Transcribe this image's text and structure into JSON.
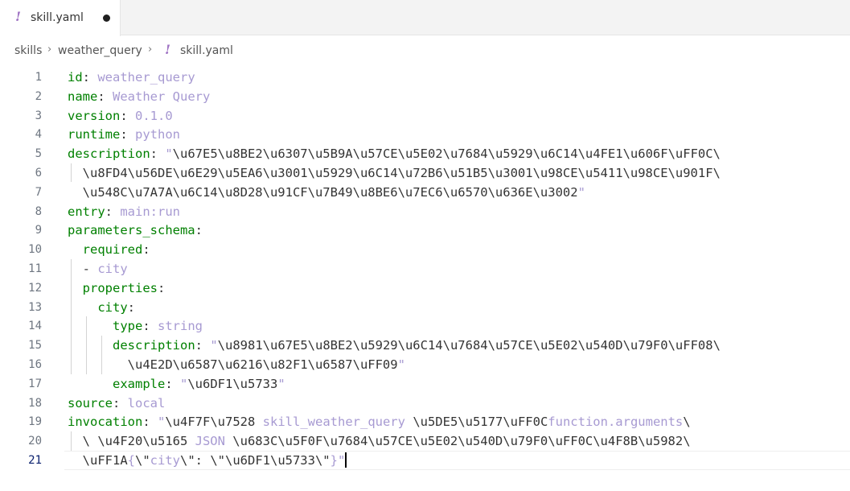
{
  "tab": {
    "icon": "yaml-exclamation-icon",
    "icon_glyph": "!",
    "label": "skill.yaml",
    "modified": true
  },
  "breadcrumb": {
    "items": [
      "skills",
      "weather_query",
      "skill.yaml"
    ],
    "separator": "›",
    "icon_glyph": "!"
  },
  "colors": {
    "key": "#008000",
    "value": "#a79ad2",
    "punctuation": "#333333",
    "yaml_icon": "#a074c4"
  },
  "cursor_line": 21,
  "lines": [
    {
      "n": "1",
      "tokens": [
        {
          "t": "id",
          "c": "k"
        },
        {
          "t": ": ",
          "c": "p"
        },
        {
          "t": "weather_query",
          "c": "v"
        }
      ]
    },
    {
      "n": "2",
      "tokens": [
        {
          "t": "name",
          "c": "k"
        },
        {
          "t": ": ",
          "c": "p"
        },
        {
          "t": "Weather Query",
          "c": "v"
        }
      ]
    },
    {
      "n": "3",
      "tokens": [
        {
          "t": "version",
          "c": "k"
        },
        {
          "t": ": ",
          "c": "p"
        },
        {
          "t": "0.1.0",
          "c": "v"
        }
      ]
    },
    {
      "n": "4",
      "tokens": [
        {
          "t": "runtime",
          "c": "k"
        },
        {
          "t": ": ",
          "c": "p"
        },
        {
          "t": "python",
          "c": "v"
        }
      ]
    },
    {
      "n": "5",
      "tokens": [
        {
          "t": "description",
          "c": "k"
        },
        {
          "t": ": ",
          "c": "p"
        },
        {
          "t": "\"",
          "c": "v"
        },
        {
          "t": "\\u67E5\\u8BE2\\u6307\\u5B9A\\u57CE\\u5E02\\u7684\\u5929\\u6C14\\u4FE1\\u606F\\uFF0C\\",
          "c": "p"
        }
      ]
    },
    {
      "n": "6",
      "tokens": [
        {
          "t": "  \\u8FD4\\u56DE\\u6E29\\u5EA6\\u3001\\u5929\\u6C14\\u72B6\\u51B5\\u3001\\u98CE\\u5411\\u98CE\\u901F\\",
          "c": "p"
        }
      ]
    },
    {
      "n": "7",
      "tokens": [
        {
          "t": "  \\u548C\\u7A7A\\u6C14\\u8D28\\u91CF\\u7B49\\u8BE6\\u7EC6\\u6570\\u636E\\u3002",
          "c": "p"
        },
        {
          "t": "\"",
          "c": "v"
        }
      ]
    },
    {
      "n": "8",
      "tokens": [
        {
          "t": "entry",
          "c": "k"
        },
        {
          "t": ": ",
          "c": "p"
        },
        {
          "t": "main:run",
          "c": "v"
        }
      ]
    },
    {
      "n": "9",
      "tokens": [
        {
          "t": "parameters_schema",
          "c": "k"
        },
        {
          "t": ":",
          "c": "p"
        }
      ]
    },
    {
      "n": "10",
      "tokens": [
        {
          "t": "  ",
          "c": "p"
        },
        {
          "t": "required",
          "c": "k"
        },
        {
          "t": ":",
          "c": "p"
        }
      ]
    },
    {
      "n": "11",
      "tokens": [
        {
          "t": "  - ",
          "c": "p"
        },
        {
          "t": "city",
          "c": "v"
        }
      ]
    },
    {
      "n": "12",
      "tokens": [
        {
          "t": "  ",
          "c": "p"
        },
        {
          "t": "properties",
          "c": "k"
        },
        {
          "t": ":",
          "c": "p"
        }
      ]
    },
    {
      "n": "13",
      "tokens": [
        {
          "t": "    ",
          "c": "p"
        },
        {
          "t": "city",
          "c": "k"
        },
        {
          "t": ":",
          "c": "p"
        }
      ]
    },
    {
      "n": "14",
      "tokens": [
        {
          "t": "      ",
          "c": "p"
        },
        {
          "t": "type",
          "c": "k"
        },
        {
          "t": ": ",
          "c": "p"
        },
        {
          "t": "string",
          "c": "v"
        }
      ]
    },
    {
      "n": "15",
      "tokens": [
        {
          "t": "      ",
          "c": "p"
        },
        {
          "t": "description",
          "c": "k"
        },
        {
          "t": ": ",
          "c": "p"
        },
        {
          "t": "\"",
          "c": "v"
        },
        {
          "t": "\\u8981\\u67E5\\u8BE2\\u5929\\u6C14\\u7684\\u57CE\\u5E02\\u540D\\u79F0\\uFF08\\",
          "c": "p"
        }
      ]
    },
    {
      "n": "16",
      "tokens": [
        {
          "t": "        \\u4E2D\\u6587\\u6216\\u82F1\\u6587\\uFF09",
          "c": "p"
        },
        {
          "t": "\"",
          "c": "v"
        }
      ]
    },
    {
      "n": "17",
      "tokens": [
        {
          "t": "      ",
          "c": "p"
        },
        {
          "t": "example",
          "c": "k"
        },
        {
          "t": ": ",
          "c": "p"
        },
        {
          "t": "\"",
          "c": "v"
        },
        {
          "t": "\\u6DF1\\u5733",
          "c": "p"
        },
        {
          "t": "\"",
          "c": "v"
        }
      ]
    },
    {
      "n": "18",
      "tokens": [
        {
          "t": "source",
          "c": "k"
        },
        {
          "t": ": ",
          "c": "p"
        },
        {
          "t": "local",
          "c": "v"
        }
      ]
    },
    {
      "n": "19",
      "tokens": [
        {
          "t": "invocation",
          "c": "k"
        },
        {
          "t": ": ",
          "c": "p"
        },
        {
          "t": "\"",
          "c": "v"
        },
        {
          "t": "\\u4F7F\\u7528 ",
          "c": "p"
        },
        {
          "t": "skill_weather_query",
          "c": "v"
        },
        {
          "t": " \\u5DE5\\u5177\\uFF0C",
          "c": "p"
        },
        {
          "t": "function.arguments",
          "c": "v"
        },
        {
          "t": "\\",
          "c": "p"
        }
      ]
    },
    {
      "n": "20",
      "tokens": [
        {
          "t": "  \\ \\u4F20\\u5165 ",
          "c": "p"
        },
        {
          "t": "JSON",
          "c": "v"
        },
        {
          "t": " \\u683C\\u5F0F\\u7684\\u57CE\\u5E02\\u540D\\u79F0\\uFF0C\\u4F8B\\u5982\\",
          "c": "p"
        }
      ]
    },
    {
      "n": "21",
      "tokens": [
        {
          "t": "  \\uFF1A",
          "c": "p"
        },
        {
          "t": "{",
          "c": "v"
        },
        {
          "t": "\\\"",
          "c": "p"
        },
        {
          "t": "city",
          "c": "v"
        },
        {
          "t": "\\\": \\\"\\u6DF1\\u5733\\\"",
          "c": "p"
        },
        {
          "t": "}\"",
          "c": "v"
        }
      ]
    }
  ]
}
